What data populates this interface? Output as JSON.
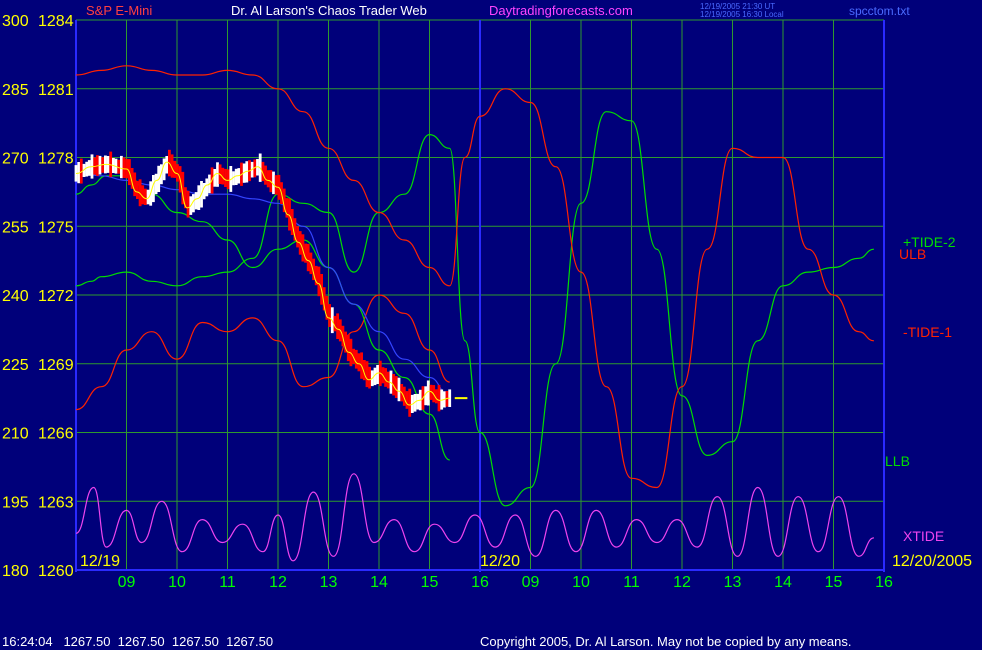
{
  "header": {
    "symbol": "S&P E-Mini",
    "title": "Dr. Al Larson's Chaos Trader Web",
    "site": "Daytradingforecasts.com",
    "time_ut": "12/19/2005 21:30 UT",
    "time_local": "12/19/2005 16:30 Local",
    "file": "spcctom.txt"
  },
  "footer": {
    "readout": "16:24:04   1267.50  1267.50  1267.50  1267.50",
    "copyright": "Copyright 2005, Dr. Al Larson. May not be copied by any means."
  },
  "colors": {
    "background": "#00007a",
    "grid": "#2e9a2e",
    "price_up": "#ffffff",
    "price_down": "#ff0000",
    "avg": "#ffff00",
    "blue_line": "#3344ff",
    "tide2": "#00dd00",
    "tide1": "#ff2200",
    "xtide": "#ee44ee",
    "label_yellow": "#ffff00",
    "label_green": "#00ff00"
  },
  "chart_data": {
    "type": "line",
    "title": "S&P E-Mini",
    "ylim_price": [
      1260,
      1284
    ],
    "ylim_osc": [
      180,
      300
    ],
    "y_ticks_osc": [
      "300",
      "285",
      "270",
      "255",
      "240",
      "225",
      "210",
      "195",
      "180"
    ],
    "y_ticks_price": [
      "1284",
      "1281",
      "1278",
      "1275",
      "1272",
      "1269",
      "1266",
      "1263",
      "1260"
    ],
    "x_ticks": [
      "09",
      "10",
      "11",
      "12",
      "13",
      "14",
      "15",
      "16",
      "09",
      "10",
      "11",
      "12",
      "13",
      "14",
      "15",
      "16"
    ],
    "date_labels": [
      "12/19",
      "12/20",
      "12/20/2005"
    ],
    "right_labels": [
      "+TIDE-2",
      "ULB",
      "-TIDE-1",
      "LLB",
      "XTIDE"
    ],
    "series": [
      {
        "name": "+TIDE-2",
        "color": "#00dd00",
        "x": [
          0,
          0.3,
          0.5,
          1,
          1.5,
          2,
          2.5,
          3,
          3.5,
          4,
          4.5,
          5,
          5.5,
          6,
          6.5,
          7,
          7.4,
          7.7,
          8,
          8.5,
          9,
          9.5,
          10,
          10.5,
          11,
          11.5,
          12,
          12.5,
          13,
          13.5,
          14,
          14.5,
          15,
          15.5,
          15.8
        ],
        "y": [
          242,
          243,
          244,
          245,
          243,
          242,
          244,
          245,
          248,
          262,
          260,
          258,
          245,
          258,
          262,
          275,
          272,
          230,
          210,
          194,
          198,
          225,
          260,
          280,
          278,
          250,
          218,
          205,
          208,
          230,
          242,
          245,
          246,
          248,
          250
        ]
      },
      {
        "name": "-TIDE-1",
        "color": "#ff2200",
        "x": [
          0,
          0.5,
          1,
          1.5,
          2,
          2.5,
          3,
          3.5,
          4,
          4.5,
          5,
          5.5,
          6,
          6.5,
          7,
          7.4,
          7.7,
          8,
          8.5,
          9,
          9.5,
          10,
          10.5,
          11,
          11.5,
          12,
          12.5,
          13,
          13.5,
          14,
          14.5,
          15,
          15.5,
          15.8
        ],
        "y": [
          288,
          289,
          290,
          289,
          288,
          288,
          289,
          288,
          285,
          280,
          272,
          265,
          258,
          252,
          246,
          242,
          270,
          279,
          285,
          282,
          268,
          245,
          220,
          200,
          198,
          220,
          250,
          272,
          270,
          270,
          250,
          240,
          232,
          230
        ]
      },
      {
        "name": "ULB",
        "color": "#ff2200",
        "x": [
          0,
          0.5,
          1,
          1.5,
          2,
          2.5,
          3,
          3.5,
          4,
          4.5,
          5,
          5.5,
          6,
          6.5,
          7,
          7.4
        ],
        "y": [
          215,
          220,
          228,
          232,
          226,
          234,
          232,
          235,
          230,
          220,
          222,
          232,
          240,
          236,
          228,
          221
        ]
      },
      {
        "name": "LLB",
        "color": "#00dd00",
        "x": [
          0,
          0.3,
          0.6,
          1,
          1.5,
          2,
          2.5,
          3,
          3.5,
          4,
          4.5,
          5,
          5.5,
          6,
          6.5,
          7,
          7.4
        ],
        "y": [
          262,
          264,
          266,
          266,
          262,
          258,
          256,
          252,
          246,
          250,
          252,
          246,
          238,
          228,
          222,
          214,
          204
        ]
      },
      {
        "name": "blue",
        "color": "#3344ff",
        "x": [
          0,
          0.5,
          1,
          1.5,
          2,
          2.5,
          3,
          3.5,
          4,
          4.5,
          5,
          5.5,
          6,
          6.5,
          7,
          7.4
        ],
        "y": [
          267,
          266,
          265,
          264,
          263,
          262,
          262,
          261,
          260,
          255,
          246,
          238,
          232,
          226,
          222,
          218
        ]
      },
      {
        "name": "XTIDE",
        "color": "#ee44ee",
        "x": [
          0,
          0.35,
          0.6,
          1,
          1.3,
          1.7,
          2.1,
          2.5,
          2.9,
          3.3,
          3.7,
          4,
          4.3,
          4.7,
          5.1,
          5.5,
          5.9,
          6.3,
          6.7,
          7.1,
          7.5,
          7.9,
          8.3,
          8.7,
          9.1,
          9.5,
          9.9,
          10.3,
          10.7,
          11.1,
          11.5,
          11.9,
          12.3,
          12.7,
          13.1,
          13.5,
          13.9,
          14.3,
          14.7,
          15.1,
          15.5,
          15.8
        ],
        "y": [
          188,
          198,
          185,
          193,
          186,
          195,
          184,
          191,
          186,
          190,
          184,
          192,
          182,
          197,
          183,
          201,
          186,
          191,
          184,
          190,
          186,
          192,
          185,
          192,
          183,
          193,
          184,
          193,
          185,
          191,
          186,
          191,
          185,
          196,
          183,
          198,
          183,
          196,
          184,
          196,
          183,
          187
        ]
      }
    ],
    "price": {
      "name": "S&P E-Mini",
      "x": [
        0,
        0.3,
        0.6,
        1,
        1.2,
        1.4,
        1.6,
        1.8,
        2.0,
        2.2,
        2.4,
        2.6,
        2.8,
        3.0,
        3.2,
        3.4,
        3.6,
        3.8,
        4.0,
        4.2,
        4.4,
        4.6,
        4.8,
        5.0,
        5.2,
        5.4,
        5.6,
        5.8,
        6.0,
        6.2,
        6.4,
        6.6,
        6.8,
        7.0,
        7.2,
        7.4
      ],
      "y": [
        1277.3,
        1277.6,
        1277.7,
        1277.5,
        1276.5,
        1276.2,
        1277,
        1277.8,
        1277.3,
        1275.8,
        1276.2,
        1276.8,
        1277.3,
        1277,
        1277.2,
        1277.4,
        1277.6,
        1277,
        1276.7,
        1275.5,
        1274.3,
        1273.5,
        1272.5,
        1271,
        1270.5,
        1269.5,
        1269,
        1268.3,
        1268.6,
        1268.2,
        1267.8,
        1267.2,
        1267.4,
        1267.8,
        1267.4,
        1267.5
      ]
    },
    "last_price_marker": 1267.5
  }
}
